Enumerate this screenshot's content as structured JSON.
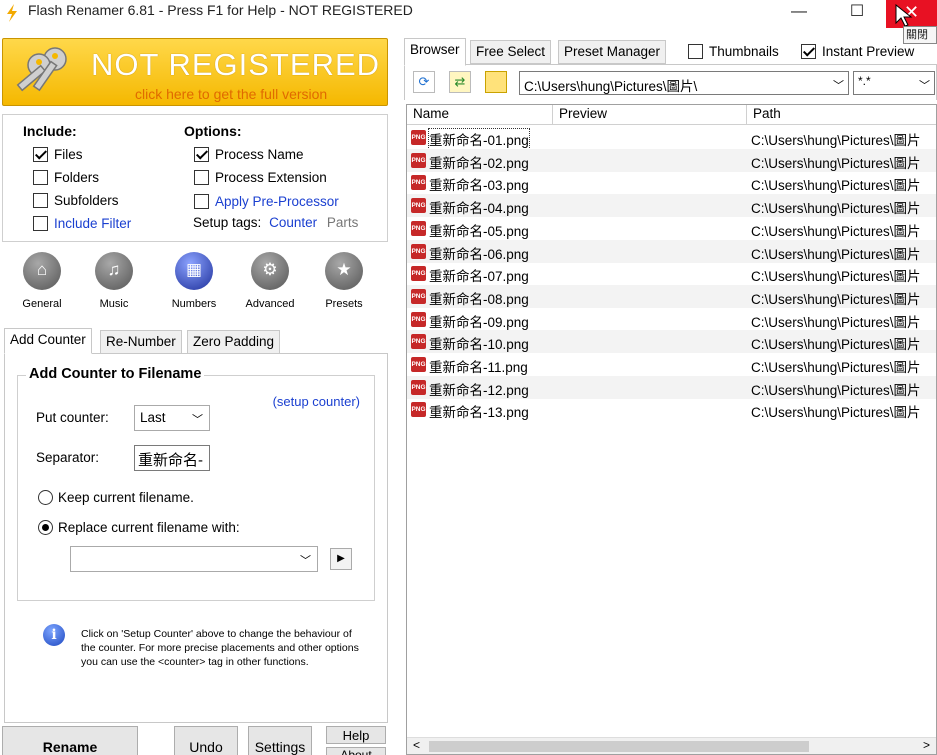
{
  "window": {
    "title": "Flash Renamer 6.81 - Press F1 for Help - NOT REGISTERED",
    "minimize": "—",
    "maximize": "☐",
    "close": "✕",
    "close_tooltip": "關閉"
  },
  "banner": {
    "title": "NOT REGISTERED",
    "subtitle": "click here to get the full version"
  },
  "include": {
    "label": "Include:",
    "files": {
      "label": "Files",
      "checked": true
    },
    "folders": {
      "label": "Folders",
      "checked": false
    },
    "subfolders": {
      "label": "Subfolders",
      "checked": false
    },
    "include_filter": {
      "label": "Include Filter",
      "checked": false
    }
  },
  "options": {
    "label": "Options:",
    "process_name": {
      "label": "Process Name",
      "checked": true
    },
    "process_extension": {
      "label": "Process Extension",
      "checked": false
    },
    "apply_preprocessor": {
      "label": "Apply Pre-Processor",
      "checked": false
    },
    "setup_tags_label": "Setup tags:",
    "counter_link": "Counter",
    "parts_link": "Parts"
  },
  "nav": [
    {
      "label": "General",
      "icon": "home-icon",
      "glyph": "⌂"
    },
    {
      "label": "Music",
      "icon": "music-icon",
      "glyph": "♫"
    },
    {
      "label": "Numbers",
      "icon": "calculator-icon",
      "glyph": "▦"
    },
    {
      "label": "Advanced",
      "icon": "gear-icon",
      "glyph": "⚙"
    },
    {
      "label": "Presets",
      "icon": "star-icon",
      "glyph": "★"
    }
  ],
  "tabs": [
    "Add Counter",
    "Re-Number",
    "Zero Padding"
  ],
  "counter": {
    "group_title": "Add Counter to Filename",
    "setup_link": "(setup counter)",
    "put_counter_label": "Put counter:",
    "put_counter_value": "Last",
    "separator_label": "Separator:",
    "separator_value": "重新命名-",
    "keep_label": "Keep current filename.",
    "replace_label": "Replace current filename with:",
    "replace_value": ""
  },
  "info_text": "Click on 'Setup Counter' above to change the behaviour of the counter. For more precise placements and other options you can use the <counter> tag in other functions.",
  "buttons": {
    "rename": "Rename",
    "undo": "Undo",
    "settings": "Settings",
    "help": "Help",
    "about": "About"
  },
  "right_tabs": [
    "Browser",
    "Free Select",
    "Preset Manager"
  ],
  "thumbnails": {
    "label": "Thumbnails",
    "checked": false
  },
  "instant_preview": {
    "label": "Instant Preview",
    "checked": true
  },
  "path": "C:\\Users\\hung\\Pictures\\圖片\\",
  "filter": "*.*",
  "columns": [
    "Name",
    "Preview",
    "Path"
  ],
  "files": [
    {
      "name": "重新命名-01.png",
      "preview": "",
      "path": "C:\\Users\\hung\\Pictures\\圖片"
    },
    {
      "name": "重新命名-02.png",
      "preview": "",
      "path": "C:\\Users\\hung\\Pictures\\圖片"
    },
    {
      "name": "重新命名-03.png",
      "preview": "",
      "path": "C:\\Users\\hung\\Pictures\\圖片"
    },
    {
      "name": "重新命名-04.png",
      "preview": "",
      "path": "C:\\Users\\hung\\Pictures\\圖片"
    },
    {
      "name": "重新命名-05.png",
      "preview": "",
      "path": "C:\\Users\\hung\\Pictures\\圖片"
    },
    {
      "name": "重新命名-06.png",
      "preview": "",
      "path": "C:\\Users\\hung\\Pictures\\圖片"
    },
    {
      "name": "重新命名-07.png",
      "preview": "",
      "path": "C:\\Users\\hung\\Pictures\\圖片"
    },
    {
      "name": "重新命名-08.png",
      "preview": "",
      "path": "C:\\Users\\hung\\Pictures\\圖片"
    },
    {
      "name": "重新命名-09.png",
      "preview": "",
      "path": "C:\\Users\\hung\\Pictures\\圖片"
    },
    {
      "name": "重新命名-10.png",
      "preview": "",
      "path": "C:\\Users\\hung\\Pictures\\圖片"
    },
    {
      "name": "重新命名-11.png",
      "preview": "",
      "path": "C:\\Users\\hung\\Pictures\\圖片"
    },
    {
      "name": "重新命名-12.png",
      "preview": "",
      "path": "C:\\Users\\hung\\Pictures\\圖片"
    },
    {
      "name": "重新命名-13.png",
      "preview": "",
      "path": "C:\\Users\\hung\\Pictures\\圖片"
    }
  ],
  "file_icon_text": "PNG",
  "colors": {
    "banner": "#f5b800",
    "banner_sub": "#e06a00",
    "link": "#1a3fd0",
    "close": "#e81123",
    "file_icon": "#c62828"
  }
}
